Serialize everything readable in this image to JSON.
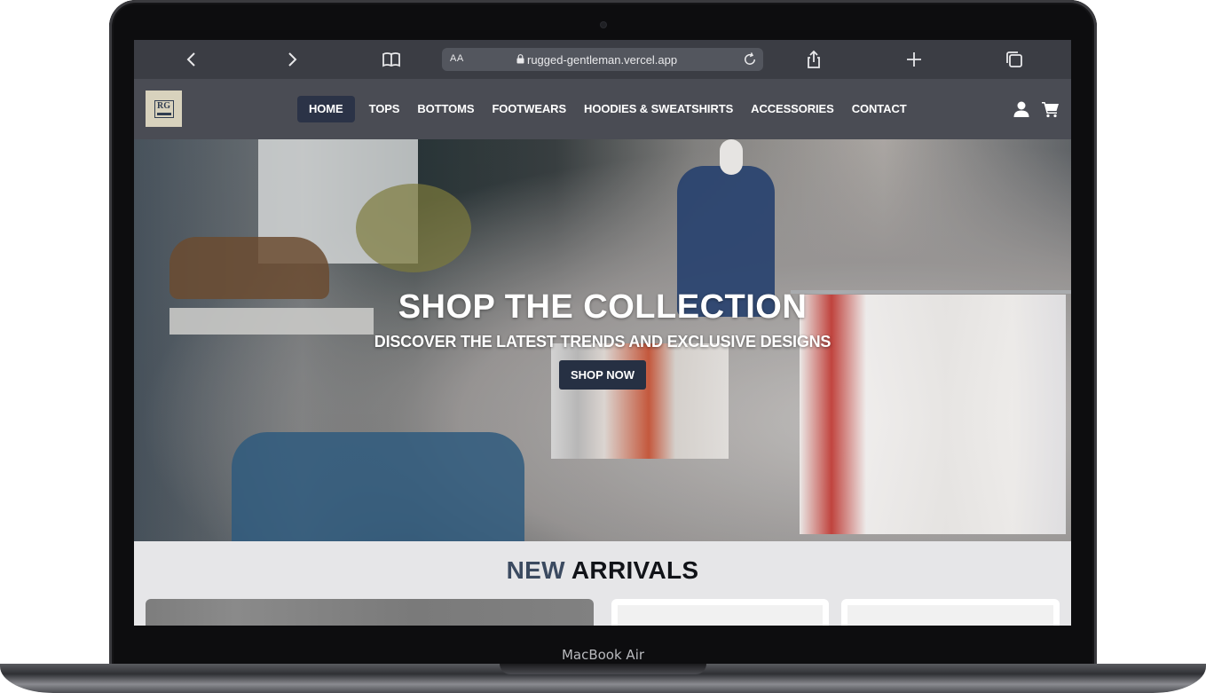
{
  "device": {
    "label": "MacBook Air"
  },
  "browser": {
    "text_size_label": "AA",
    "url": "rugged-gentleman.vercel.app"
  },
  "site": {
    "logo_text": "RG",
    "nav": [
      {
        "label": "HOME",
        "active": true
      },
      {
        "label": "TOPS"
      },
      {
        "label": "BOTTOMS"
      },
      {
        "label": "FOOTWEARS"
      },
      {
        "label": "HOODIES & SWEATSHIRTS"
      },
      {
        "label": "ACCESSORIES"
      },
      {
        "label": "CONTACT"
      }
    ],
    "header_icons": [
      "user-icon",
      "cart-icon"
    ]
  },
  "hero": {
    "title": "SHOP THE COLLECTION",
    "subtitle": "DISCOVER THE LATEST TRENDS AND EXCLUSIVE DESIGNS",
    "cta_label": "SHOP NOW"
  },
  "arrivals": {
    "title_word1": "NEW",
    "title_word2": "ARRIVALS"
  },
  "colors": {
    "header_bg": "#4a4c54",
    "accent": "#263043",
    "page_bg": "#e6e6e8"
  }
}
